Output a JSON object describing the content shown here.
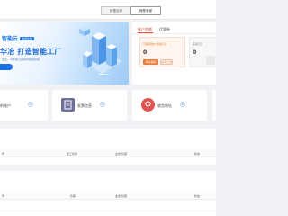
{
  "header": {
    "tabs": [
      {
        "label": "我是买家"
      },
      {
        "label": "我是卖家"
      }
    ]
  },
  "banner": {
    "logo_text": "智能云",
    "logo_tag": "免费注册",
    "slogan": "华冶 打造智能工厂",
    "subline": "企业，为新能云提供智能园系统"
  },
  "account": {
    "tabs": [
      {
        "label": "账户余额"
      },
      {
        "label": "优惠券"
      }
    ],
    "balance": {
      "label": "可提取账户余额(元)",
      "value": "0",
      "recharge_label": "申请提取",
      "withdraw_label": "提现记录"
    },
    "side": {
      "label": "冻结(元)",
      "value": "0"
    }
  },
  "stats": [
    {
      "label": "的账户",
      "count": "0"
    },
    {
      "label": "发票信息",
      "count": "0"
    },
    {
      "label": "收货地址",
      "count": "0"
    }
  ],
  "table1": {
    "columns": [
      "号",
      "加工仓库",
      "业务员/部",
      "状态"
    ]
  },
  "table2": {
    "columns": [
      "号",
      "仓库",
      "业务员/部",
      "状态"
    ]
  },
  "colors": {
    "accent": "#1a73e8",
    "orange": "#e87a3c",
    "red_tab": "#e74c3c"
  }
}
